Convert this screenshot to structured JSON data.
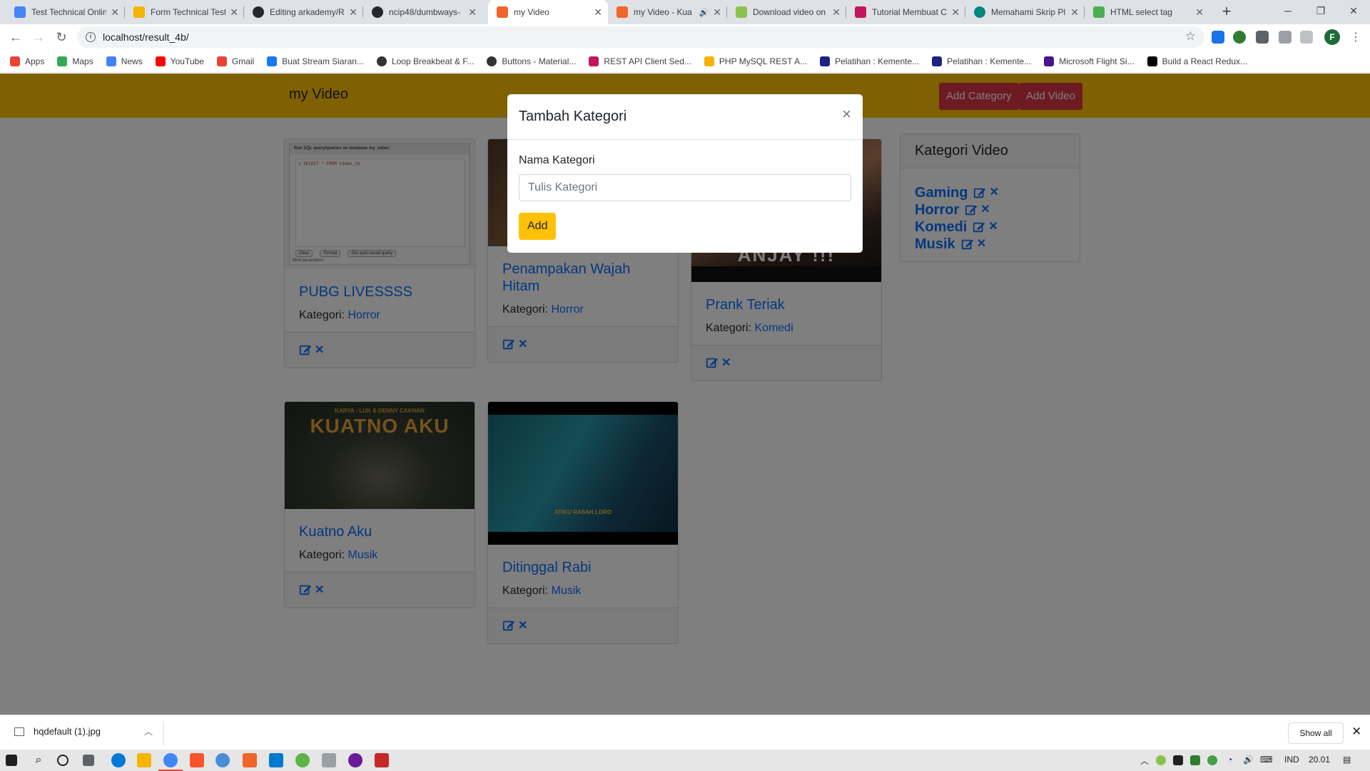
{
  "browser": {
    "tabs": [
      {
        "title": "Test Technical Onlin",
        "color": "#4285f4"
      },
      {
        "title": "Form Technical Test",
        "color": "#f4b400"
      },
      {
        "title": "Editing arkademy/R",
        "color": "#24292e"
      },
      {
        "title": "ncip48/dumbways-",
        "color": "#24292e"
      },
      {
        "title": "my Video",
        "color": "#f06529",
        "active": true
      },
      {
        "title": "my Video - Kua",
        "color": "#f06529",
        "audio": true
      },
      {
        "title": "Download video on",
        "color": "#8bc34a"
      },
      {
        "title": "Tutorial Membuat C",
        "color": "#c2185b"
      },
      {
        "title": "Memahami Skrip Pl",
        "color": "#00897b"
      },
      {
        "title": "HTML select tag",
        "color": "#4caf50"
      }
    ],
    "url": "localhost/result_4b/",
    "profile_initial": "F",
    "bookmarks": [
      {
        "label": "Apps",
        "color": "#ea4335"
      },
      {
        "label": "Maps",
        "color": "#34a853"
      },
      {
        "label": "News",
        "color": "#4285f4"
      },
      {
        "label": "YouTube",
        "color": "#ff0000"
      },
      {
        "label": "Gmail",
        "color": "#ea4335"
      },
      {
        "label": "Buat Stream Siaran...",
        "color": "#1877f2"
      },
      {
        "label": "Loop Breakbeat & F...",
        "color": "#333333"
      },
      {
        "label": "Buttons - Material...",
        "color": "#333333"
      },
      {
        "label": "REST API Client Sed...",
        "color": "#c2185b"
      },
      {
        "label": "PHP MySQL REST A...",
        "color": "#f4b400"
      },
      {
        "label": "Pelatihan : Kemente...",
        "color": "#1a237e"
      },
      {
        "label": "Pelatihan : Kemente...",
        "color": "#1a237e"
      },
      {
        "label": "Microsoft Flight Si...",
        "color": "#4a148c"
      },
      {
        "label": "Build a React Redux...",
        "color": "#000000"
      }
    ]
  },
  "navbar": {
    "brand": "my Video",
    "add_category": "Add Category",
    "add_video": "Add Video"
  },
  "videos": [
    {
      "title": "PUBG LIVESSSS",
      "category_label": "Kategori:",
      "category": "Horror",
      "thumb": "sql"
    },
    {
      "title": "Penampakan Wajah Hitam",
      "category_label": "Kategori:",
      "category": "Horror",
      "thumb": "dark"
    },
    {
      "title": "Prank Teriak",
      "category_label": "Kategori:",
      "category": "Komedi",
      "thumb": "prank",
      "overlay_text": "ANJAY !!!"
    },
    {
      "title": "Kuatno Aku",
      "category_label": "Kategori:",
      "category": "Musik",
      "thumb": "forest",
      "overlay_text": "KUATNO AKU",
      "overlay_sub": "KARYA : LUK & DENNY CAKNAN"
    },
    {
      "title": "Ditinggal Rabi",
      "category_label": "Kategori:",
      "category": "Musik",
      "thumb": "teal",
      "overlay_text": "ATIKU RASAH LORO"
    }
  ],
  "sql_thumb": {
    "header": "Run SQL query/queries on database my_video:",
    "query": "1  SELECT * FROM video_tb",
    "buttons": [
      "Clear",
      "Format",
      "Get auto-saved query"
    ],
    "bind": "Bind parameters"
  },
  "sidebar": {
    "title": "Kategori Video",
    "categories": [
      "Gaming",
      "Horror",
      "Komedi",
      "Musik"
    ]
  },
  "modal": {
    "title": "Tambah Kategori",
    "close": "×",
    "label": "Nama Kategori",
    "placeholder": "Tulis Kategori",
    "button": "Add"
  },
  "download_bar": {
    "filename": "hqdefault (1).jpg",
    "show_all": "Show all"
  },
  "taskbar": {
    "language": "IND",
    "time": "20.01"
  },
  "colors": {
    "primary": "#0d6efd",
    "warning": "#ffc107",
    "danger": "#dc3545"
  }
}
